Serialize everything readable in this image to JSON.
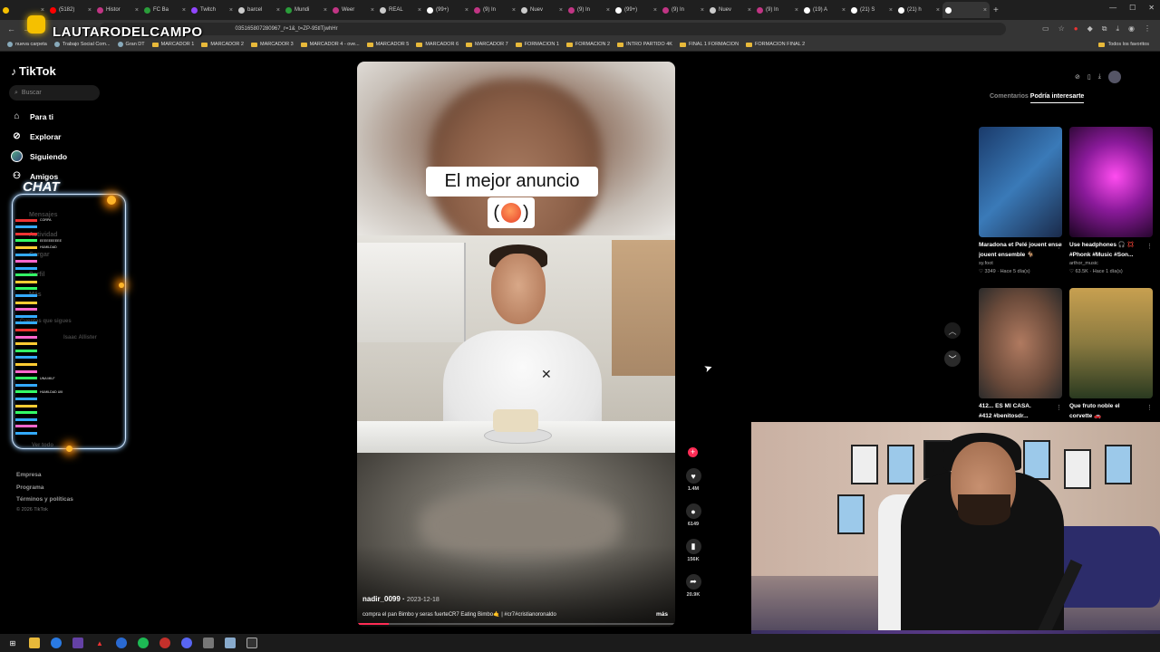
{
  "browser": {
    "tabs": [
      {
        "label": "",
        "color": "#f5c000"
      },
      {
        "label": "(5182)",
        "color": "#ff0000"
      },
      {
        "label": "Histor",
        "color": "#c13584"
      },
      {
        "label": "FC Ba",
        "color": "#2a9d3a"
      },
      {
        "label": "Twitch",
        "color": "#9146ff"
      },
      {
        "label": "barcel",
        "color": "#ccc"
      },
      {
        "label": "Mundi",
        "color": "#2a9d3a"
      },
      {
        "label": "Weer",
        "color": "#c13584"
      },
      {
        "label": "REAL",
        "color": "#ccc"
      },
      {
        "label": "(99+)",
        "color": "#fff"
      },
      {
        "label": "(9) In",
        "color": "#c13584"
      },
      {
        "label": "Nuev",
        "color": "#ccc"
      },
      {
        "label": "(9) In",
        "color": "#c13584"
      },
      {
        "label": "(99+)",
        "color": "#fff"
      },
      {
        "label": "(9) In",
        "color": "#c13584"
      },
      {
        "label": "Nuev",
        "color": "#ccc"
      },
      {
        "label": "(9) In",
        "color": "#c13584"
      },
      {
        "label": "(19) A",
        "color": "#fff"
      },
      {
        "label": "(21) S",
        "color": "#fff"
      },
      {
        "label": "(21) h",
        "color": "#fff"
      },
      {
        "label": "",
        "color": "#fff",
        "active": true
      }
    ],
    "url": "035165807280967_r=1&_t=ZP-95tlTjwhHr",
    "bookmarks": [
      "nueva carpeta",
      "Trabajo Social Com...",
      "Gran DT",
      "MARCADOR 1",
      "MARCADOR 2",
      "MARCADOR 3",
      "MARCADOR 4 - ove...",
      "MARCADOR 5",
      "MARCADOR 6",
      "MARCADOR 7",
      "FORMACION 1",
      "FORMACION 2",
      "INTRO PARTIDO 4K",
      "FINAL 1 FORMACION",
      "FORMACION FINAL 2"
    ],
    "all_bookmarks": "Todos los favoritos"
  },
  "overlay": {
    "streamer": "LAUTARODELCAMPO",
    "chat_title": "CHAT",
    "chat_messages": [
      {
        "user": "",
        "text": "CORPA",
        "color": "#e33"
      },
      {
        "user": "",
        "text": "",
        "color": "#3af"
      },
      {
        "user": "",
        "text": "",
        "color": "#e33"
      },
      {
        "user": "",
        "text": "EEEEEEEEEE",
        "color": "#3f6"
      },
      {
        "user": "",
        "text": "HUMILDAD",
        "color": "#fc3"
      },
      {
        "user": "",
        "text": "",
        "color": "#3af"
      },
      {
        "user": "",
        "text": "",
        "color": "#f6c"
      },
      {
        "user": "",
        "text": "",
        "color": "#3af"
      },
      {
        "user": "",
        "text": "",
        "color": "#3f6"
      },
      {
        "user": "",
        "text": "",
        "color": "#fc3"
      },
      {
        "user": "",
        "text": "",
        "color": "#3f6"
      },
      {
        "user": "",
        "text": "",
        "color": "#3af"
      },
      {
        "user": "",
        "text": "",
        "color": "#fc3"
      },
      {
        "user": "",
        "text": "",
        "color": "#f6c"
      },
      {
        "user": "",
        "text": "",
        "color": "#3af"
      },
      {
        "user": "",
        "text": "",
        "color": "#3af"
      },
      {
        "user": "",
        "text": "",
        "color": "#e33"
      },
      {
        "user": "",
        "text": "",
        "color": "#f6c"
      },
      {
        "user": "",
        "text": "",
        "color": "#fc3"
      },
      {
        "user": "",
        "text": "",
        "color": "#3f6"
      },
      {
        "user": "",
        "text": "",
        "color": "#3af"
      },
      {
        "user": "",
        "text": "",
        "color": "#fc3"
      },
      {
        "user": "",
        "text": "",
        "color": "#f6c"
      },
      {
        "user": "",
        "text": "UNA MILF",
        "color": "#3f6"
      },
      {
        "user": "",
        "text": "",
        "color": "#3af"
      },
      {
        "user": "",
        "text": "HUMILDAD UIII",
        "color": "#3f6"
      },
      {
        "user": "",
        "text": "",
        "color": "#3af"
      },
      {
        "user": "",
        "text": "",
        "color": "#fc3"
      },
      {
        "user": "",
        "text": "",
        "color": "#3f6"
      },
      {
        "user": "",
        "text": "",
        "color": "#3af"
      },
      {
        "user": "",
        "text": "",
        "color": "#f6c"
      },
      {
        "user": "",
        "text": "",
        "color": "#3af"
      }
    ]
  },
  "tiktok": {
    "logo": "TikTok",
    "search_placeholder": "Buscar",
    "nav": [
      {
        "label": "Para ti",
        "icon": "home-icon"
      },
      {
        "label": "Explorar",
        "icon": "compass-icon"
      },
      {
        "label": "Siguiendo",
        "icon": "avatar-icon"
      },
      {
        "label": "Amigos",
        "icon": "friends-icon"
      }
    ],
    "ghost_labels": [
      "Mensajes",
      "Actividad",
      "Cargar",
      "Perfil",
      "Más",
      "Cuentas que sigues",
      "Isaac Allister",
      "Ver todo"
    ],
    "footer": [
      "Empresa",
      "Programa",
      "Términos y políticas"
    ],
    "copyright": "© 2026 TikTok"
  },
  "video": {
    "caption_line1": "El mejor anuncio",
    "caption_open": "(",
    "caption_close": ")",
    "author": "nadir_0099",
    "date": "2023-12-18",
    "description": "compra el pan Bimbo y seras fuerteCR7 Eating Bimbo🤙 | #cr7#cristianoronaldo",
    "more": "más",
    "progress": 0.1,
    "likes": "1.4M",
    "comments": "6149",
    "saves": "156K",
    "shares": "20.9K"
  },
  "right_panel": {
    "tab_comments": "Comentarios",
    "tab_interesting": "Podría interesarte",
    "cards": [
      {
        "title": "Maradona et Pelé jouent ensemble ⚽...",
        "line2": "jouent ensemble 🐐",
        "author": "sy.foot",
        "meta": "♡ 3349 · Hace 5 día(s)",
        "bg": "linear-gradient(135deg,#1a3a6a,#3a7ab8 50%,#1a2a4a)"
      },
      {
        "title": "Use headphones 🎧 💢",
        "line2": "#Phonk #Music #Son...",
        "author": "arthor_music",
        "meta": "♡ 63.5K · Hace 1 día(s)",
        "bg": "radial-gradient(circle at 55% 45%,#ff4cf0,#8a1a9a 45%,#1a0420)"
      },
      {
        "title": "412... ES MI CASA.",
        "line2": "#412 #benitosdr...",
        "author": "",
        "meta": "",
        "bg": "radial-gradient(ellipse at 50% 50%,#b07a60,#6a4a3a 60%,#2a2a2a)"
      },
      {
        "title": "Que fruto noble el",
        "line2": "corvette 🚗",
        "author": "",
        "meta": "",
        "bg": "linear-gradient(180deg,#c8a050,#8a7a40 50%,#2a3a20)"
      }
    ]
  }
}
